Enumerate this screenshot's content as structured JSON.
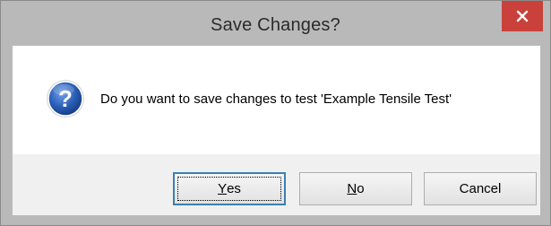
{
  "dialog": {
    "title": "Save Changes?",
    "message": "Do you want to save changes to test 'Example Tensile Test'",
    "icon": "question-icon",
    "buttons": {
      "yes": {
        "accel": "Y",
        "rest": "es"
      },
      "no": {
        "accel": "N",
        "rest": "o"
      },
      "cancel": "Cancel"
    },
    "colors": {
      "close_button": "#c9413a",
      "icon_blue": "#1c4fa3"
    }
  }
}
